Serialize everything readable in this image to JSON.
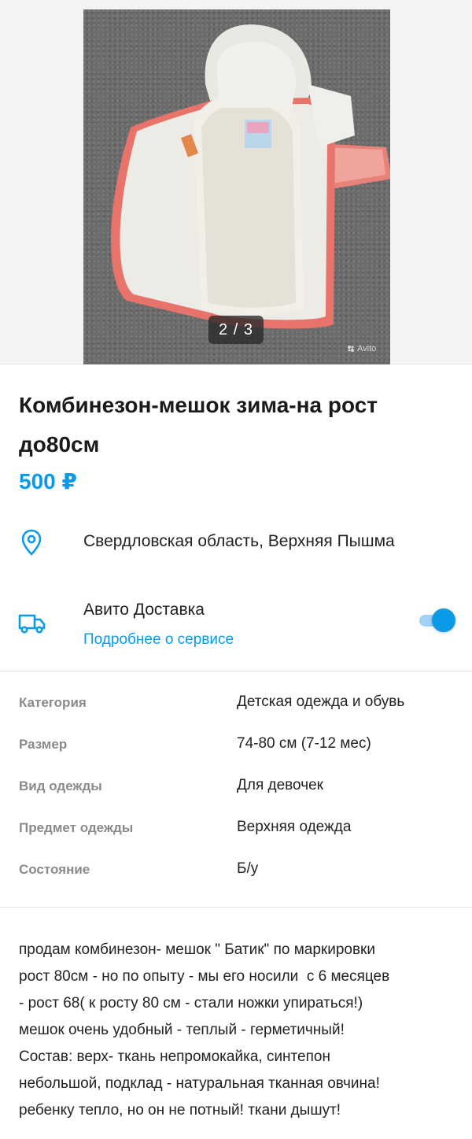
{
  "gallery": {
    "counter": "2 / 3",
    "watermark": "Avito",
    "photo_subject": "baby-winter-sleeping-bag-photo"
  },
  "listing": {
    "title": "Комбинезон-мешок зима-на рост до80см",
    "price": "500 ₽"
  },
  "location": {
    "icon": "location-pin-icon",
    "text": "Свердловская область, Верхняя Пышма"
  },
  "delivery": {
    "icon": "truck-icon",
    "title": "Авито Доставка",
    "link": "Подробнее о сервисе",
    "enabled": true
  },
  "params": [
    {
      "label": "Категория",
      "value": "Детская одежда и обувь"
    },
    {
      "label": "Размер",
      "value": "74-80 см (7-12 мес)"
    },
    {
      "label": "Вид одежды",
      "value": "Для девочек"
    },
    {
      "label": "Предмет одежды",
      "value": "Верхняя одежда"
    },
    {
      "label": "Состояние",
      "value": "Б/у"
    }
  ],
  "description": "продам комбинезон- мешок \" Батик\" по маркировки\nрост 80см - но по опыту - мы его носили  с 6 месяцев\n- рост 68( к росту 80 см - стали ножки упираться!)\nмешок очень удобный - теплый - герметичный!\nСостав: верх- ткань непромокайка, синтепон\nнебольшой, подклад - натуральная тканная овчина!\nребенку тепло, но он не потный! ткани дышут!",
  "colors": {
    "accent": "#0a9ae8",
    "muted": "#8a8a8a"
  }
}
